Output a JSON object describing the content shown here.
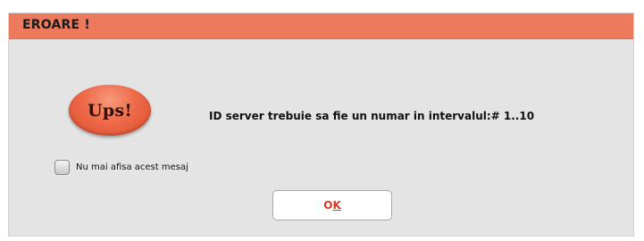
{
  "dialog": {
    "title": "EROARE !",
    "badge_text": "Ups!",
    "message": "ID server trebuie sa fie un numar in intervalul:# 1..10",
    "checkbox": {
      "label": "Nu mai afisa acest mesaj",
      "checked": false
    },
    "ok_button": {
      "label_first": "O",
      "label_underlined": "K"
    }
  },
  "colors": {
    "titlebar": "#ee7a5e",
    "dialog_bg": "#e4e4e4",
    "badge": "#ee6a48",
    "ok_text": "#d23a22"
  }
}
